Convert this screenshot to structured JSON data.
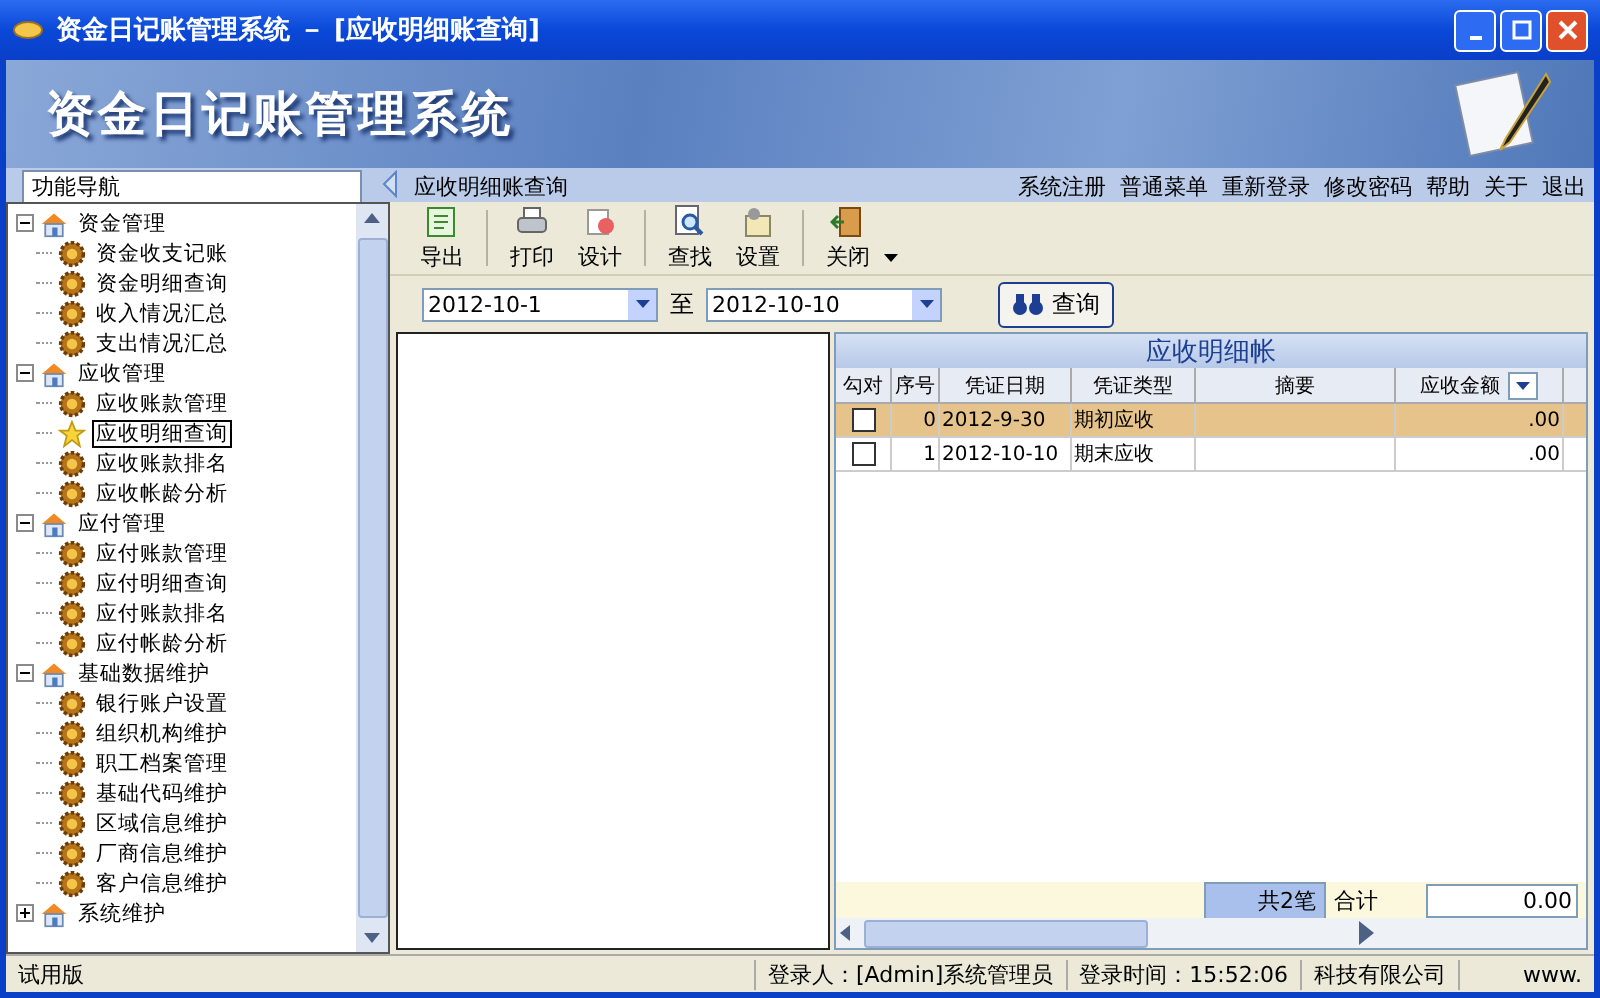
{
  "window": {
    "title": "资金日记账管理系统 － [应收明细账查询]"
  },
  "banner": {
    "title": "资金日记账管理系统"
  },
  "nav_tab": {
    "label": "功能导航"
  },
  "page_title": "应收明细账查询",
  "top_menu": [
    "系统注册",
    "普通菜单",
    "重新登录",
    "修改密码",
    "帮助",
    "关于",
    "退出"
  ],
  "tree": [
    {
      "label": "资金管理",
      "expanded": true,
      "children": [
        {
          "label": "资金收支记账",
          "selected": false
        },
        {
          "label": "资金明细查询",
          "selected": false
        },
        {
          "label": "收入情况汇总",
          "selected": false
        },
        {
          "label": "支出情况汇总",
          "selected": false
        }
      ]
    },
    {
      "label": "应收管理",
      "expanded": true,
      "children": [
        {
          "label": "应收账款管理",
          "selected": false
        },
        {
          "label": "应收明细查询",
          "selected": true
        },
        {
          "label": "应收账款排名",
          "selected": false
        },
        {
          "label": "应收帐龄分析",
          "selected": false
        }
      ]
    },
    {
      "label": "应付管理",
      "expanded": true,
      "children": [
        {
          "label": "应付账款管理",
          "selected": false
        },
        {
          "label": "应付明细查询",
          "selected": false
        },
        {
          "label": "应付账款排名",
          "selected": false
        },
        {
          "label": "应付帐龄分析",
          "selected": false
        }
      ]
    },
    {
      "label": "基础数据维护",
      "expanded": true,
      "children": [
        {
          "label": "银行账户设置",
          "selected": false
        },
        {
          "label": "组织机构维护",
          "selected": false
        },
        {
          "label": "职工档案管理",
          "selected": false
        },
        {
          "label": "基础代码维护",
          "selected": false
        },
        {
          "label": "区域信息维护",
          "selected": false
        },
        {
          "label": "厂商信息维护",
          "selected": false
        },
        {
          "label": "客户信息维护",
          "selected": false
        }
      ]
    },
    {
      "label": "系统维护",
      "expanded": false
    }
  ],
  "toolbar": [
    {
      "label": "导出",
      "kind": "export"
    },
    {
      "label": "打印",
      "kind": "print"
    },
    {
      "label": "设计",
      "kind": "design"
    },
    {
      "label": "查找",
      "kind": "find"
    },
    {
      "label": "设置",
      "kind": "settings"
    },
    {
      "label": "关闭",
      "kind": "close"
    }
  ],
  "filter": {
    "from": "2012-10-1",
    "to_label": "至",
    "to": "2012-10-10",
    "query_button": "查询"
  },
  "grid": {
    "title": "应收明细帐",
    "check_column": "勾对",
    "columns": [
      "序号",
      "凭证日期",
      "凭证类型",
      "摘要",
      "应收金额"
    ],
    "rows": [
      {
        "checked": false,
        "selected": true,
        "cells": [
          "0",
          "2012-9-30",
          "期初应收",
          "",
          ".00"
        ]
      },
      {
        "checked": false,
        "selected": false,
        "cells": [
          "1",
          "2012-10-10",
          "期末应收",
          "",
          ".00"
        ]
      }
    ],
    "footer_count": "共2笔",
    "footer_label": "合计",
    "footer_total": "0.00"
  },
  "status_bar": [
    "试用版",
    "登录人：[Admin]系统管理员",
    "登录时间：15:52:06",
    "科技有限公司",
    "www."
  ]
}
